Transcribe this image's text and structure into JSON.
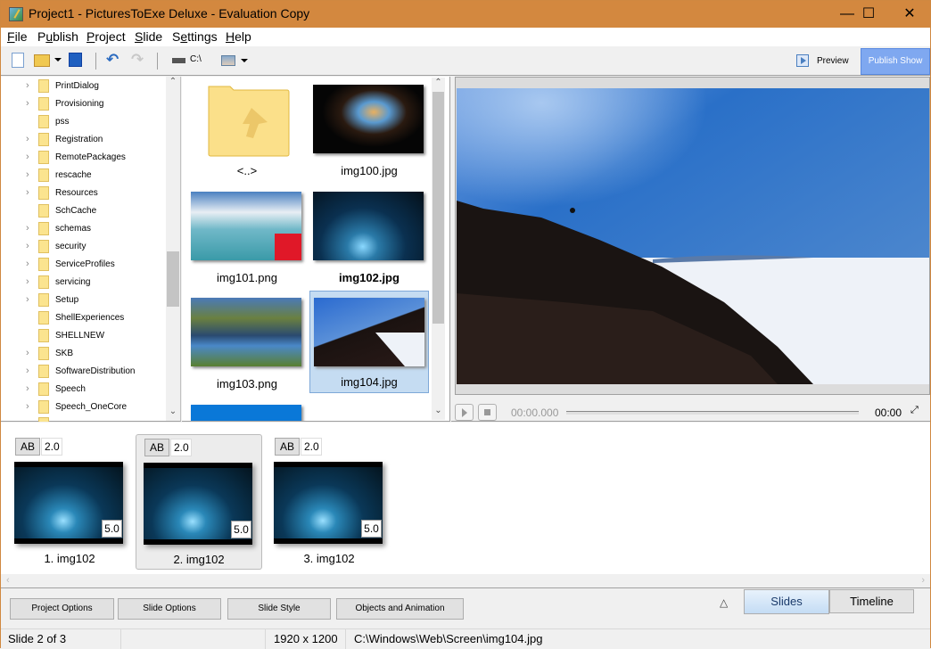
{
  "window": {
    "title": "Project1 - PicturesToExe Deluxe - Evaluation Copy",
    "minimize": "—",
    "maximize": "☐",
    "close": "✕",
    "accent_color": "#d3883f"
  },
  "menu": {
    "items": [
      {
        "label": "File",
        "mnemonic": "F",
        "rest": "ile"
      },
      {
        "label": "Publish",
        "pre": "P",
        "mnemonic": "u",
        "rest": "blish"
      },
      {
        "label": "Project",
        "mnemonic": "P",
        "rest": "roject"
      },
      {
        "label": "Slide",
        "mnemonic": "S",
        "rest": "lide"
      },
      {
        "label": "Settings",
        "pre": "S",
        "mnemonic": "e",
        "rest": "ttings"
      },
      {
        "label": "Help",
        "mnemonic": "H",
        "rest": "elp"
      }
    ]
  },
  "toolbar": {
    "icons": [
      "new-file-icon",
      "open-folder-icon",
      "dropdown-arrow-icon",
      "save-icon",
      "undo-icon",
      "redo-icon",
      "drive-icon",
      "view-mode-icon",
      "dropdown-arrow-icon"
    ],
    "drive_label": "C:\\",
    "preview_label": "Preview",
    "publish_label": "Publish Show"
  },
  "folder_tree": {
    "items": [
      {
        "label": "PrintDialog",
        "expandable": true
      },
      {
        "label": "Provisioning",
        "expandable": true
      },
      {
        "label": "pss",
        "expandable": false
      },
      {
        "label": "Registration",
        "expandable": true
      },
      {
        "label": "RemotePackages",
        "expandable": true
      },
      {
        "label": "rescache",
        "expandable": true
      },
      {
        "label": "Resources",
        "expandable": true
      },
      {
        "label": "SchCache",
        "expandable": false
      },
      {
        "label": "schemas",
        "expandable": true
      },
      {
        "label": "security",
        "expandable": true
      },
      {
        "label": "ServiceProfiles",
        "expandable": true
      },
      {
        "label": "servicing",
        "expandable": true
      },
      {
        "label": "Setup",
        "expandable": true
      },
      {
        "label": "ShellExperiences",
        "expandable": false
      },
      {
        "label": "SHELLNEW",
        "expandable": false
      },
      {
        "label": "SKB",
        "expandable": true
      },
      {
        "label": "SoftwareDistribution",
        "expandable": true
      },
      {
        "label": "Speech",
        "expandable": true
      },
      {
        "label": "Speech_OneCore",
        "expandable": true
      }
    ]
  },
  "file_browser": {
    "items": [
      {
        "name": "<..>",
        "type": "parent-folder",
        "bold": false,
        "selected": false
      },
      {
        "name": "img100.jpg",
        "type": "image",
        "bold": false,
        "selected": false
      },
      {
        "name": "img101.png",
        "type": "image",
        "bold": false,
        "selected": false
      },
      {
        "name": "img102.jpg",
        "type": "image",
        "bold": true,
        "selected": false
      },
      {
        "name": "img103.png",
        "type": "image",
        "bold": false,
        "selected": false
      },
      {
        "name": "img104.jpg",
        "type": "image",
        "bold": false,
        "selected": true
      },
      {
        "name": "",
        "type": "image",
        "bold": false,
        "selected": false
      }
    ]
  },
  "player": {
    "current_time": "00:00.000",
    "total_time": "00:00",
    "progress": 0
  },
  "slides": {
    "items": [
      {
        "label": "1. img102",
        "transition": "AB",
        "transition_duration": "2.0",
        "duration": "5.0",
        "selected": false
      },
      {
        "label": "2. img102",
        "transition": "AB",
        "transition_duration": "2.0",
        "duration": "5.0",
        "selected": true
      },
      {
        "label": "3. img102",
        "transition": "AB",
        "transition_duration": "2.0",
        "duration": "5.0",
        "selected": false
      }
    ]
  },
  "bottom_buttons": {
    "project_options": "Project Options",
    "slide_options": "Slide Options",
    "slide_style": "Slide Style",
    "objects_animation": "Objects and Animation",
    "collapse": "△",
    "slides_tab": "Slides",
    "timeline_tab": "Timeline"
  },
  "status": {
    "slide_position": "Slide 2 of 3",
    "resolution": "1920 x 1200",
    "file_path": "C:\\Windows\\Web\\Screen\\img104.jpg"
  }
}
